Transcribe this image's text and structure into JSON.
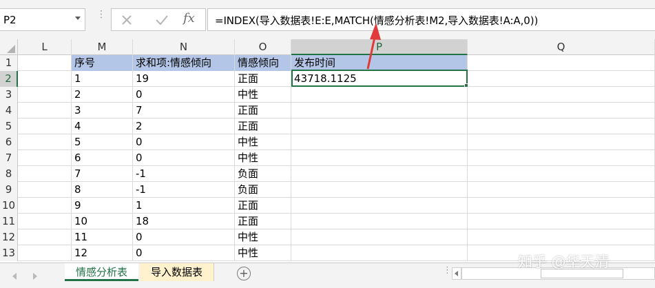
{
  "name_box": {
    "value": "P2"
  },
  "formula_bar": {
    "fx_label": "fx",
    "formula": "=INDEX(导入数据表!E:E,MATCH(情感分析表!M2,导入数据表!A:A,0))"
  },
  "columns": [
    "L",
    "M",
    "N",
    "O",
    "P",
    "Q"
  ],
  "selected_column": "P",
  "rows": [
    {
      "num": "1",
      "cells": [
        "",
        "序号",
        "求和项:情感倾向",
        "情感倾向",
        "发布时间",
        ""
      ]
    },
    {
      "num": "2",
      "cells": [
        "",
        "1",
        "19",
        "正面",
        "43718.1125",
        ""
      ]
    },
    {
      "num": "3",
      "cells": [
        "",
        "2",
        "0",
        "中性",
        "",
        ""
      ]
    },
    {
      "num": "4",
      "cells": [
        "",
        "3",
        "7",
        "正面",
        "",
        ""
      ]
    },
    {
      "num": "5",
      "cells": [
        "",
        "4",
        "2",
        "正面",
        "",
        ""
      ]
    },
    {
      "num": "6",
      "cells": [
        "",
        "5",
        "0",
        "中性",
        "",
        ""
      ]
    },
    {
      "num": "7",
      "cells": [
        "",
        "6",
        "0",
        "中性",
        "",
        ""
      ]
    },
    {
      "num": "8",
      "cells": [
        "",
        "7",
        "-1",
        "负面",
        "",
        ""
      ]
    },
    {
      "num": "9",
      "cells": [
        "",
        "8",
        "-1",
        "负面",
        "",
        ""
      ]
    },
    {
      "num": "10",
      "cells": [
        "",
        "9",
        "1",
        "正面",
        "",
        ""
      ]
    },
    {
      "num": "11",
      "cells": [
        "",
        "10",
        "18",
        "正面",
        "",
        ""
      ]
    },
    {
      "num": "12",
      "cells": [
        "",
        "11",
        "0",
        "中性",
        "",
        ""
      ]
    },
    {
      "num": "13",
      "cells": [
        "",
        "12",
        "0",
        "中性",
        "",
        ""
      ]
    }
  ],
  "selected_row": "2",
  "sheet_tabs": [
    {
      "label": "情感分析表",
      "active": true
    },
    {
      "label": "导入数据表",
      "active": false
    }
  ],
  "add_sheet_label": "+",
  "watermark": "知乎 @华天清",
  "colors": {
    "header_fill": "#b4c6e7",
    "accent": "#217346",
    "arrow": "#e03a3a",
    "import_tab": "#fff2cc"
  }
}
